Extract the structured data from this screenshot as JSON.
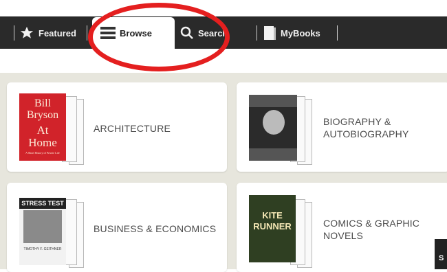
{
  "nav": {
    "items": [
      {
        "label": "Featured",
        "icon": "star-icon"
      },
      {
        "label": "Browse",
        "icon": "menu-lines-icon"
      },
      {
        "label": "Search",
        "icon": "search-icon"
      },
      {
        "label": "MyBooks",
        "icon": "book-icon"
      }
    ],
    "active": "Browse"
  },
  "annotation": {
    "shape": "red circle highlighting Browse tab",
    "color": "#e41f1f"
  },
  "categories": [
    {
      "label": "ARCHITECTURE",
      "cover_text": [
        "Bill",
        "Bryson",
        "At",
        "Home",
        "A Short History of Private Life"
      ]
    },
    {
      "label_lines": [
        "BIOGRAPHY &",
        "AUTOBIOGRAPHY"
      ]
    },
    {
      "label": "BUSINESS & ECONOMICS",
      "cover_text": [
        "STRESS TEST",
        "TIMOTHY F. GEITHNER"
      ]
    },
    {
      "label_lines": [
        "COMICS & GRAPHIC",
        "NOVELS"
      ],
      "cover_text": [
        "KITE",
        "RUNNER"
      ]
    }
  ],
  "corner_fragment": "S",
  "colors": {
    "navbar": "#2a2a2a",
    "content_bg": "#e7e6dd",
    "active_tab": "#ffffff"
  }
}
